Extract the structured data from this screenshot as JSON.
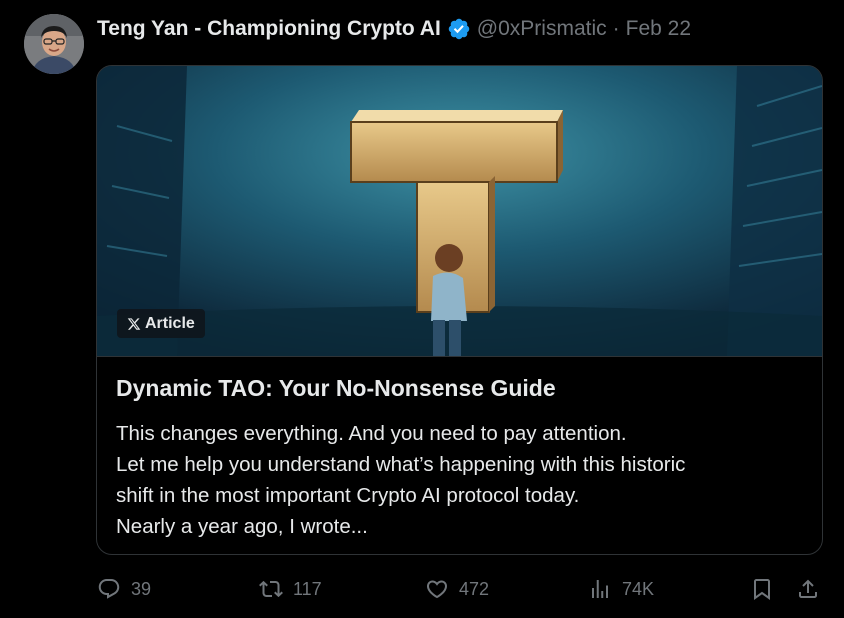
{
  "tweet": {
    "author_name": "Teng Yan - Championing Crypto AI",
    "handle": "@0xPrismatic",
    "separator": "·",
    "date": "Feb 22",
    "verified": true
  },
  "card": {
    "badge_label": "Article",
    "title": "Dynamic TAO: Your No-Nonsense Guide",
    "body_lines": [
      "This changes everything. And you need to pay attention.",
      "Let me help you understand what’s happening with this historic",
      "shift in the most important Crypto AI protocol today.",
      "Nearly a year ago, I wrote..."
    ]
  },
  "actions": {
    "replies": "39",
    "reposts": "117",
    "likes": "472",
    "views": "74K"
  },
  "icons": {
    "verified": "verified-badge-icon",
    "x_logo": "x-logo-icon",
    "reply": "reply-icon",
    "repost": "repost-icon",
    "like": "heart-icon",
    "views": "views-chart-icon",
    "bookmark": "bookmark-icon",
    "share": "share-icon"
  },
  "colors": {
    "background": "#000000",
    "text_primary": "#e7e9ea",
    "text_secondary": "#71767b",
    "border": "#2f3336",
    "verified_blue": "#1d9bf0"
  }
}
